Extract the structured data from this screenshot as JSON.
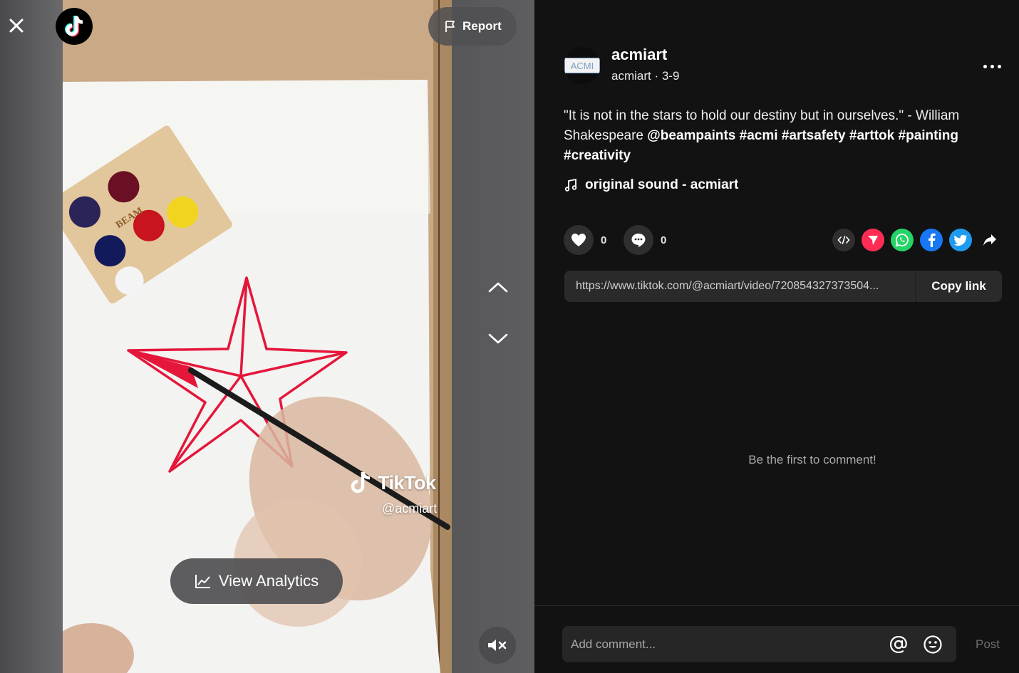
{
  "video": {
    "report_label": "Report",
    "watermark_brand": "TikTok",
    "watermark_handle": "@acmiart",
    "analytics_label": "View Analytics"
  },
  "post": {
    "avatar_text": "ACMI",
    "username": "acmiart",
    "subline": "acmiart · 3-9",
    "caption_text": "\"It is not in the stars to hold our destiny but in ourselves.\" - William Shakespeare ",
    "mention": "@beampaints",
    "hashtags": [
      "#acmi",
      "#artsafety",
      "#arttok",
      "#painting",
      "#creativity"
    ],
    "sound": "original sound - acmiart",
    "like_count": "0",
    "comment_count": "0",
    "share_link": "https://www.tiktok.com/@acmiart/video/720854327373504...",
    "copy_label": "Copy link"
  },
  "comments": {
    "empty_text": "Be the first to comment!",
    "placeholder": "Add comment...",
    "post_label": "Post"
  },
  "colors": {
    "tiktok_red": "#fe2c55",
    "whatsapp": "#25d366",
    "facebook": "#1877f2",
    "twitter": "#1d9bf0"
  }
}
